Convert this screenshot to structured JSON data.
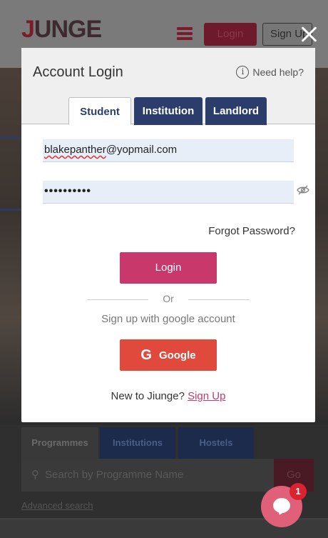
{
  "background": {
    "logo": {
      "prefix": "J",
      "rest": "UNGE"
    },
    "header": {
      "login_label": "Login",
      "signup_label": "Sign Up"
    },
    "search_tabs": [
      "Programmes",
      "Institutions",
      "Hostels"
    ],
    "search_placeholder": "Search by Programme Name",
    "go_label": "Go",
    "advanced_search": "Advanced search"
  },
  "modal": {
    "title": "Account Login",
    "help_label": "Need help?",
    "tabs": [
      {
        "label": "Student",
        "active": true
      },
      {
        "label": "Institution",
        "active": false
      },
      {
        "label": "Landlord",
        "active": false
      }
    ],
    "email": {
      "misspelled_part": "blakepanther",
      "rest": "@yopmail.com"
    },
    "password_masked": "••••••••••",
    "forgot_password": "Forgot Password?",
    "login_button": "Login",
    "or_text": "Or",
    "google_prompt": "Sign up with google account",
    "google_button": {
      "icon_letter": "G",
      "label": "Google"
    },
    "new_user_text": "New to Jiunge?",
    "signup_link": "Sign Up"
  },
  "chat": {
    "badge_count": "1"
  },
  "colors": {
    "primary_navy": "#2a3d6b",
    "login_pink": "#c8386a",
    "google_red": "#e04a3c",
    "badge_red": "#d9232f",
    "input_bg": "#e8eef8"
  },
  "icons": [
    "info-icon",
    "eye-off-icon",
    "close-icon",
    "chat-icon",
    "search-icon",
    "menu-icon"
  ]
}
